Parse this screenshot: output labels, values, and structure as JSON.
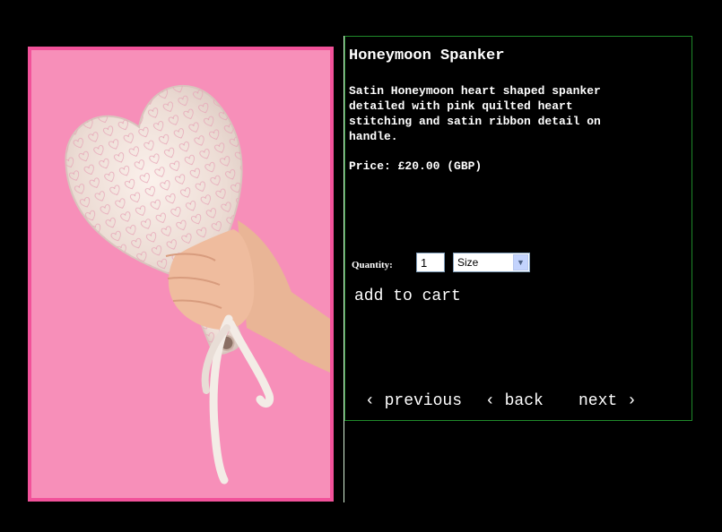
{
  "product": {
    "title": "Honeymoon Spanker",
    "description": "Satin Honeymoon heart shaped spanker detailed with pink quilted heart stitching and satin ribbon detail on handle.",
    "price": "Price: £20.00 (GBP)"
  },
  "form": {
    "quantity_label": "Quantity:",
    "quantity_value": "1",
    "size_selected": "Size",
    "add_to_cart": "add to cart"
  },
  "nav": {
    "previous": "‹ previous",
    "back": "‹ back",
    "next": "next ›"
  },
  "colors": {
    "background": "#000000",
    "photo_border": "#f2529a",
    "photo_background": "#f78fb9",
    "panel_border": "#1f8a2a"
  }
}
